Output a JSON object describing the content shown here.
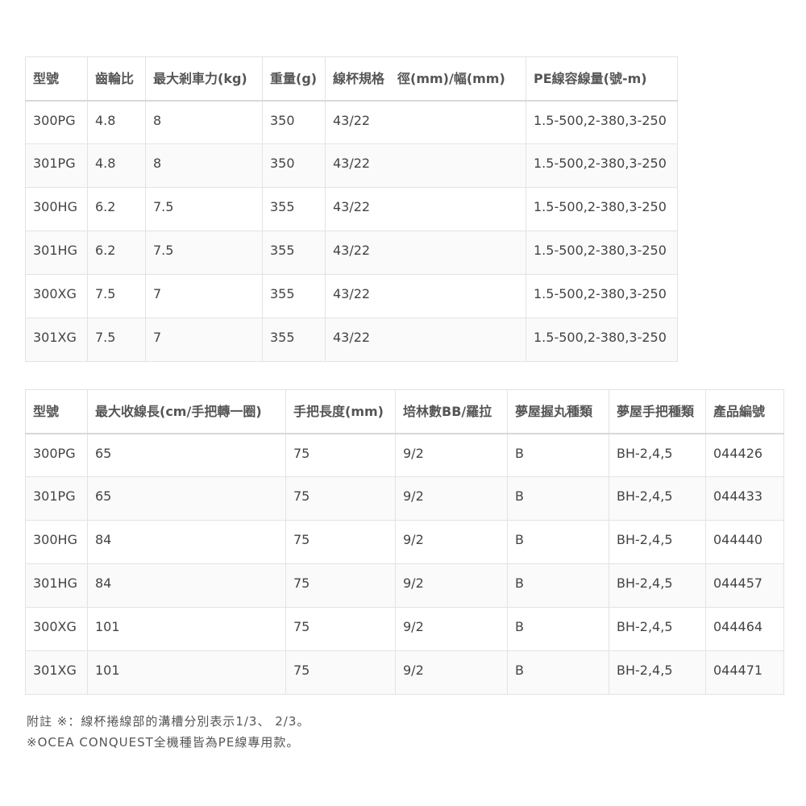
{
  "table1": {
    "headers": [
      "型號",
      "齒輪比",
      "最大剎車力(kg)",
      "重量(g)",
      "線杯規格　徑(mm)/幅(mm)",
      "PE線容線量(號-m)"
    ],
    "rows": [
      [
        "300PG",
        "4.8",
        "8",
        "350",
        "43/22",
        "1.5-500,2-380,3-250"
      ],
      [
        "301PG",
        "4.8",
        "8",
        "350",
        "43/22",
        "1.5-500,2-380,3-250"
      ],
      [
        "300HG",
        "6.2",
        "7.5",
        "355",
        "43/22",
        "1.5-500,2-380,3-250"
      ],
      [
        "301HG",
        "6.2",
        "7.5",
        "355",
        "43/22",
        "1.5-500,2-380,3-250"
      ],
      [
        "300XG",
        "7.5",
        "7",
        "355",
        "43/22",
        "1.5-500,2-380,3-250"
      ],
      [
        "301XG",
        "7.5",
        "7",
        "355",
        "43/22",
        "1.5-500,2-380,3-250"
      ]
    ]
  },
  "table2": {
    "headers": [
      "型號",
      "最大收線長(cm/手把轉一圈)",
      "手把長度(mm)",
      "培林數BB/羅拉",
      "夢屋握丸種類",
      "夢屋手把種類",
      "產品編號"
    ],
    "rows": [
      [
        "300PG",
        "65",
        "75",
        "9/2",
        "B",
        "BH-2,4,5",
        "044426"
      ],
      [
        "301PG",
        "65",
        "75",
        "9/2",
        "B",
        "BH-2,4,5",
        "044433"
      ],
      [
        "300HG",
        "84",
        "75",
        "9/2",
        "B",
        "BH-2,4,5",
        "044440"
      ],
      [
        "301HG",
        "84",
        "75",
        "9/2",
        "B",
        "BH-2,4,5",
        "044457"
      ],
      [
        "300XG",
        "101",
        "75",
        "9/2",
        "B",
        "BH-2,4,5",
        "044464"
      ],
      [
        "301XG",
        "101",
        "75",
        "9/2",
        "B",
        "BH-2,4,5",
        "044471"
      ]
    ]
  },
  "notes": [
    "附註 ※：線杯捲線部的溝槽分別表示1/3、 2/3。",
    "※OCEA CONQUEST全機種皆為PE線專用款。"
  ]
}
